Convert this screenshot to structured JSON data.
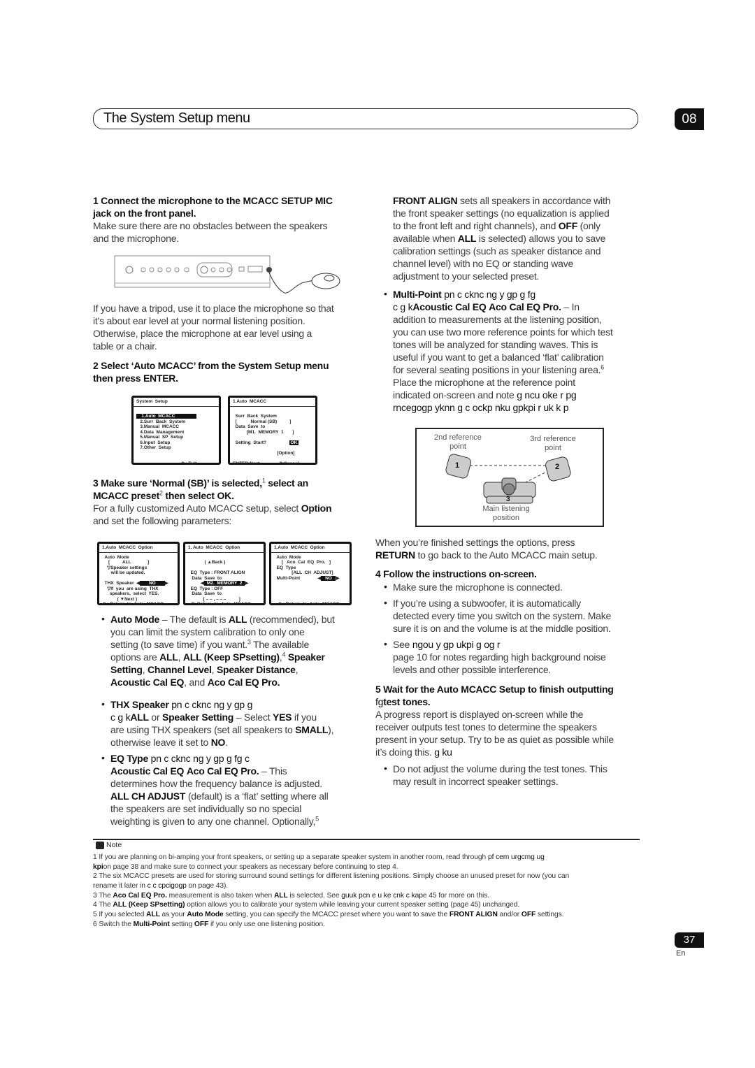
{
  "header": {
    "title": "The System Setup menu",
    "chapter": "08"
  },
  "left": {
    "step1": [
      [
        {
          "t": "1   Connect the microphone to the MCACC SETUP MIC",
          "b": true
        }
      ],
      [
        {
          "t": "jack on the front panel.",
          "b": true
        }
      ],
      [
        "Make sure there are no obstacles between the speakers"
      ],
      [
        "and the microphone."
      ]
    ],
    "tripod": [
      [
        "If you have a tripod, use it to place the microphone so that"
      ],
      [
        "it’s about ear level at your normal listening position."
      ],
      [
        "Otherwise, place the microphone at ear level using a"
      ],
      [
        "table or a chair."
      ]
    ],
    "step2": [
      [
        {
          "t": "2   Select ‘Auto MCACC’ from the System Setup menu",
          "b": true
        }
      ],
      [
        {
          "t": "then press ENTER.",
          "b": true
        }
      ]
    ],
    "step3": [
      [
        {
          "t": "3   Make sure ‘Normal (SB)’ is selected,",
          "b": true
        },
        {
          "t": "1",
          "sup": true
        },
        {
          "t": " select an",
          "b": true
        }
      ],
      [
        {
          "t": "MCACC preset",
          "b": true
        },
        {
          "t": "2",
          "sup": true
        },
        {
          "t": " then select OK.",
          "b": true
        }
      ],
      [
        "For a fully customized Auto MCACC setup, select ",
        {
          "t": "Option",
          "b": true
        }
      ],
      [
        "and set the following parameters:"
      ]
    ],
    "auto_mode": [
      [
        {
          "t": "Auto Mode",
          "b": true
        },
        " – The default is ",
        {
          "t": "ALL",
          "b": true
        },
        " (recommended), but"
      ],
      [
        "you can limit the system calibration to only one"
      ],
      [
        "setting (to save time) if you want.",
        {
          "t": "3",
          "sup": true
        },
        " The available"
      ],
      [
        "options are ",
        {
          "t": "ALL",
          "b": true
        },
        ", ",
        {
          "t": "ALL (Keep SPsetting)",
          "b": true
        },
        ",",
        {
          "t": "4",
          "sup": true
        },
        " ",
        {
          "t": "Speaker",
          "b": true
        }
      ],
      [
        {
          "t": "Setting",
          "b": true
        },
        ", ",
        {
          "t": "Channel Level",
          "b": true
        },
        ", ",
        {
          "t": "Speaker Distance",
          "b": true
        },
        ","
      ],
      [
        {
          "t": "Acoustic Cal EQ",
          "b": true
        },
        ", and ",
        {
          "t": "Aco Cal EQ Pro.",
          "b": true
        }
      ]
    ],
    "thx": [
      [
        {
          "t": "THX Speaker",
          "b": true
        },
        {
          "t": "    pn   c  cknc  ng  y gp     g",
          "g": true
        }
      ],
      [
        {
          "t": "c      g  k",
          "g": true
        },
        {
          "t": "ALL",
          "b": true
        },
        " or ",
        {
          "t": "Speaker Setting",
          "b": true
        },
        "  – Select ",
        {
          "t": "YES",
          "b": true
        },
        " if you"
      ],
      [
        "are using THX speakers (set all speakers to ",
        {
          "t": "SMALL",
          "b": true
        },
        "),"
      ],
      [
        "otherwise leave it set to ",
        {
          "t": "NO",
          "b": true
        },
        "."
      ]
    ],
    "eq_type": [
      [
        {
          "t": "EQ Type",
          "b": true
        },
        {
          "t": "    pn   c  cknc  ng  y gp     g                    fg  c",
          "g": true
        }
      ],
      [
        {
          "t": "Acoustic Cal EQ",
          "b": true
        },
        "     ",
        {
          "t": "Aco Cal EQ Pro.",
          "b": true
        },
        "  – This"
      ],
      [
        "determines how the frequency balance is adjusted."
      ],
      [
        {
          "t": "ALL CH ADJUST",
          "b": true
        },
        " (default) is a ‘flat’ setting where all"
      ],
      [
        "the speakers are set individually so no special"
      ],
      [
        "weighting is given to any one channel. Optionally,",
        {
          "t": "5",
          "sup": true
        }
      ]
    ],
    "screens1": [
      [
        [
          {
            "t": "System  Setup"
          }
        ],
        [
          ""
        ],
        [
          {
            "t": "   1.Auto  MCACC                ",
            "inv": true
          }
        ],
        [
          "   2.Surr  Back  System"
        ],
        [
          "   3.Manual  MCACC"
        ],
        [
          "   4.Data  Management"
        ],
        [
          "   5.Manual  SP  Setup"
        ],
        [
          "   6.Input  Setup"
        ],
        [
          "   7.Other  Setup"
        ],
        [
          ""
        ],
        [
          ""
        ],
        [
          "                                   ↶ : Exit"
        ]
      ],
      [
        [
          {
            "t": "1.Auto  MCACC"
          }
        ],
        [
          ""
        ],
        [
          "  Surr  Back  System"
        ],
        [
          "  [           Normal (SB)          ]"
        ],
        [
          "  Data  Save  to"
        ],
        [
          "           [M1.  MEMORY  1       ]"
        ],
        [
          ""
        ],
        [
          "  Setting  Start?                  ",
          {
            "t": "OK",
            "inv": true
          }
        ],
        [
          ""
        ],
        [
          "                                   [Option]"
        ],
        [
          ""
        ],
        [
          "ENTER:Next               ↶:Cancel"
        ]
      ]
    ],
    "screens2": [
      [
        [
          {
            "t": "1.Auto  MCACC  Option"
          }
        ],
        [
          "  Auto  Mode"
        ],
        [
          "     [          ALL             ]"
        ],
        [
          "    ▽Speaker settings"
        ],
        [
          "       will be updated."
        ],
        [
          ""
        ],
        [
          "  THX  Speaker  ◀",
          {
            "t": "      NO      ",
            "inv": true
          },
          "▶"
        ],
        [
          "    ▽If  you  are using  THX"
        ],
        [
          "      speakers,  select  YES."
        ],
        [
          "            ( ▼Next )"
        ],
        [
          "↶ : Return  to  Auto  MCACC"
        ]
      ],
      [
        [
          {
            "t": "1. Auto  MCACC  Option"
          }
        ],
        [
          ""
        ],
        [
          "             ( ▲Back )"
        ],
        [
          ""
        ],
        [
          "  EQ  Type : FRONT ALIGN"
        ],
        [
          "   Data  Save  to"
        ],
        [
          "          ◀",
          {
            "t": " M2.  MEMORY  2 ",
            "inv": true
          },
          "▶"
        ],
        [
          "  EQ  Type : OFF"
        ],
        [
          "   Data  Save  to"
        ],
        [
          "            [ – – , – – –          ]"
        ],
        [
          "  ↶: Return  to  Auto  MCACC"
        ]
      ],
      [
        [
          {
            "t": "1.Auto  MCACC  Option"
          }
        ],
        [
          "  Auto  Mode"
        ],
        [
          "      [   Aco  Cal  EQ  Pro.   ]"
        ],
        [
          "  EQ  Type"
        ],
        [
          "              [ALL  CH  ADJUST]"
        ],
        [
          "  Multi-Point              ◀",
          {
            "t": "  NO  ",
            "inv": true
          },
          "▶"
        ],
        [
          ""
        ],
        [
          ""
        ],
        [
          ""
        ],
        [
          ""
        ],
        [
          "   ↶ : Return  to  Auto  MCACC"
        ]
      ]
    ]
  },
  "right": {
    "front_align": [
      [
        {
          "t": "FRONT ALIGN",
          "b": true
        },
        " sets all speakers in accordance with"
      ],
      [
        "the front speaker settings (no equalization is applied"
      ],
      [
        "to the front left and right channels), and ",
        {
          "t": "OFF",
          "b": true
        },
        " (only"
      ],
      [
        "available when ",
        {
          "t": "ALL",
          "b": true
        },
        " is selected) allows you to save"
      ],
      [
        "calibration settings (such as speaker distance and"
      ],
      [
        "channel level) with no EQ or standing wave"
      ],
      [
        "adjustment to your selected preset."
      ]
    ],
    "multi_point": [
      [
        {
          "t": "Multi-Point",
          "b": true
        },
        {
          "t": "     pn    c  cknc  ng  y gp     g                   fg",
          "g": true
        }
      ],
      [
        {
          "t": "c      g  k",
          "g": true
        },
        {
          "t": "Acoustic Cal EQ",
          "b": true
        },
        "     ",
        {
          "t": "Aco Cal EQ Pro.",
          "b": true
        },
        "  – In"
      ],
      [
        "addition to measurements at the listening position,"
      ],
      [
        "you can use two more reference points for which test"
      ],
      [
        "tones will be analyzed for standing waves. This is"
      ],
      [
        "useful if you want to get a balanced ‘flat’ calibration"
      ],
      [
        "for several seating positions in your listening area.",
        {
          "t": "6",
          "sup": true
        }
      ],
      [
        "Place the microphone at the reference point"
      ],
      [
        "indicated on-screen and note  ",
        {
          "t": "  g  ncu    oke    r   pg",
          "g": true
        }
      ],
      [
        {
          "t": "rncegogp    yknn     g  c              ockp  nku  gpkpi  r  uk  k  p",
          "g": true
        }
      ]
    ],
    "diagram": {
      "ref2": [
        "2nd reference",
        "point"
      ],
      "ref3": [
        "3rd reference",
        "point"
      ],
      "main": [
        "Main listening",
        "position"
      ],
      "n1": "1",
      "n2": "2",
      "n3": "3"
    },
    "finished": [
      [
        "When you’re finished settings the options, press"
      ],
      [
        {
          "t": "RETURN",
          "b": true
        },
        " to go back to the Auto MCACC main setup."
      ]
    ],
    "step4": [
      [
        {
          "t": "4   Follow the instructions on-screen.",
          "b": true
        }
      ]
    ],
    "mic": [
      [
        "Make sure the microphone is connected."
      ]
    ],
    "sub": [
      [
        "If you’re using a subwoofer, it is automatically"
      ],
      [
        "detected every time you switch on the system. Make"
      ],
      [
        "sure it is on and the volume is at the middle position."
      ]
    ],
    "see": [
      [
        "See  ",
        {
          "t": "      ngou  y gp     ukpi       g                              og       r",
          "g": true
        }
      ],
      [
        "page 10 for notes regarding high background noise"
      ],
      [
        "levels and other possible interference."
      ]
    ],
    "step5": [
      [
        {
          "t": "5   Wait for the Auto MCACC Setup to finish outputting",
          "b": true
        }
      ],
      [
        {
          "t": "fg",
          "g": true
        },
        {
          "t": "test tones.",
          "b": true
        }
      ],
      [
        "A progress report is displayed on-screen while the"
      ],
      [
        "receiver outputs test tones to determine the speakers"
      ],
      [
        "present in your setup. Try to be as quiet as possible while"
      ],
      [
        "it’s doing this.",
        {
          "t": "  g  ku",
          "g": true
        }
      ]
    ],
    "volume": [
      [
        "Do not adjust the volume during the test tones. This"
      ],
      [
        "may result in incorrect speaker settings."
      ]
    ]
  },
  "notes": {
    "label": "Note",
    "lines": [
      [
        "1 If you are planning on bi-amping your front speakers, or setting up a separate speaker system in another room, read through                ",
        {
          "t": "pf    cem  urgcmg   ug",
          "g": true
        }
      ],
      [
        {
          "t": "  kpi",
          "b": true
        },
        "on page 38 and make sure to connect your speakers as necessary before continuing to step 4."
      ],
      [
        "2 The six MCACC presets are used for storing surround sound settings for different listening positions. Simply choose an unused preset for now (you can"
      ],
      [
        "rename it later in  ",
        {
          "t": " c  c    cpcigogp",
          "g": true
        },
        " on page 43)."
      ],
      [
        "3 The ",
        {
          "t": "Aco Cal EQ Pro.",
          "b": true
        },
        " measurement is also taken when ",
        {
          "t": "ALL",
          "b": true
        },
        " is selected. See          ",
        {
          "t": "guuk  pcn    e     u  ke    cnk   c  kap",
          "g": true
        },
        "e 45 for more on this."
      ],
      [
        "4 The ",
        {
          "t": "ALL (Keep SPsetting)",
          "b": true
        },
        " option allows you to calibrate your system while leaving your current speaker setting (page 45) unchanged."
      ],
      [
        "5 If you selected ",
        {
          "t": "ALL",
          "b": true
        },
        " as your ",
        {
          "t": "Auto Mode",
          "b": true
        },
        " setting, you can specify the MCACC preset where you want to save the ",
        {
          "t": "FRONT ALIGN",
          "b": true
        },
        " and/or ",
        {
          "t": "OFF",
          "b": true
        },
        " settings."
      ],
      [
        "6 Switch the ",
        {
          "t": "Multi-Point",
          "b": true
        },
        " setting ",
        {
          "t": "OFF",
          "b": true
        },
        " if you only use one listening position."
      ]
    ]
  },
  "footer": {
    "page": "37",
    "lang": "En"
  }
}
